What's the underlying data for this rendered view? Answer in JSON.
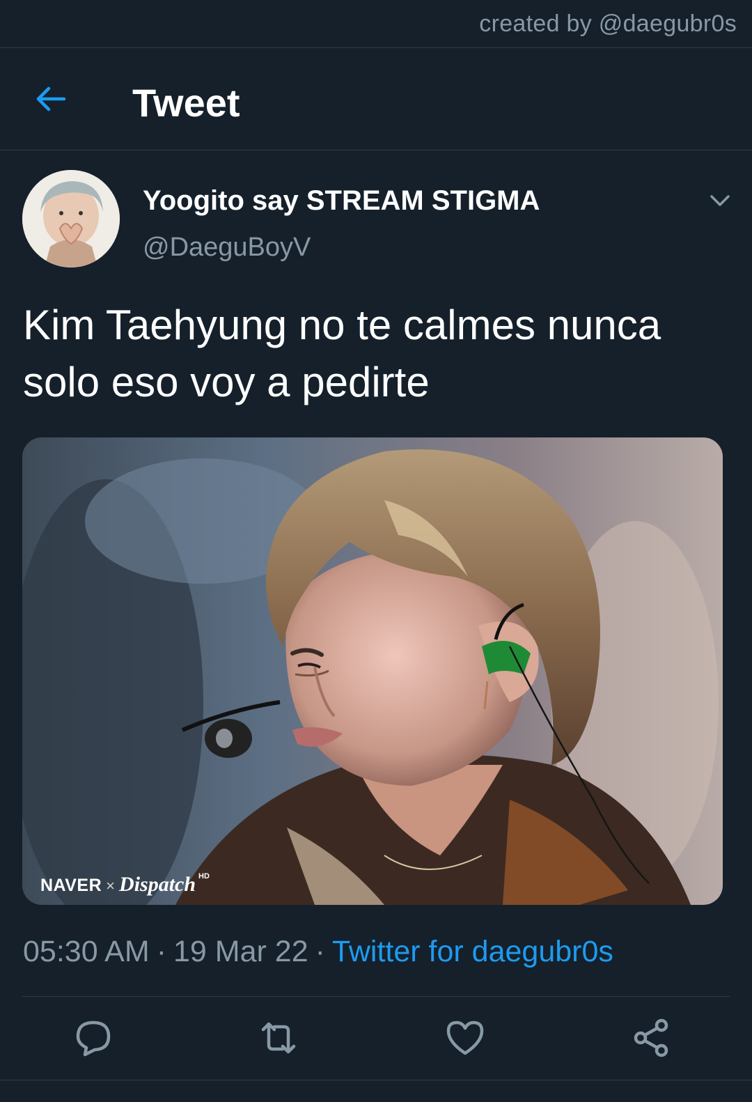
{
  "credit": {
    "text": "created by @daegubr0s"
  },
  "header": {
    "title": "Tweet",
    "back_icon": "arrow-left-icon"
  },
  "author": {
    "display_name": "Yoogito say STREAM STIGMA",
    "handle": "@DaeguBoyV",
    "menu_icon": "chevron-down-icon"
  },
  "tweet": {
    "text_line1": "Kim Taehyung no te calmes nunca",
    "text_line2": "solo eso voy a pedirte"
  },
  "media": {
    "watermark_naver": "NAVER",
    "watermark_x": "×",
    "watermark_dispatch": "Dispatch",
    "watermark_hd": "HD"
  },
  "meta": {
    "time": "05:30 AM",
    "dot1": "·",
    "date": "19 Mar 22",
    "dot2": "·",
    "source": "Twitter for daegubr0s"
  },
  "actions": {
    "reply_icon": "reply-icon",
    "retweet_icon": "retweet-icon",
    "like_icon": "heart-icon",
    "share_icon": "share-icon"
  },
  "colors": {
    "background": "#15202b",
    "accent": "#1d9bf0",
    "secondary_text": "#8899a6",
    "divider": "#2f3b47"
  }
}
